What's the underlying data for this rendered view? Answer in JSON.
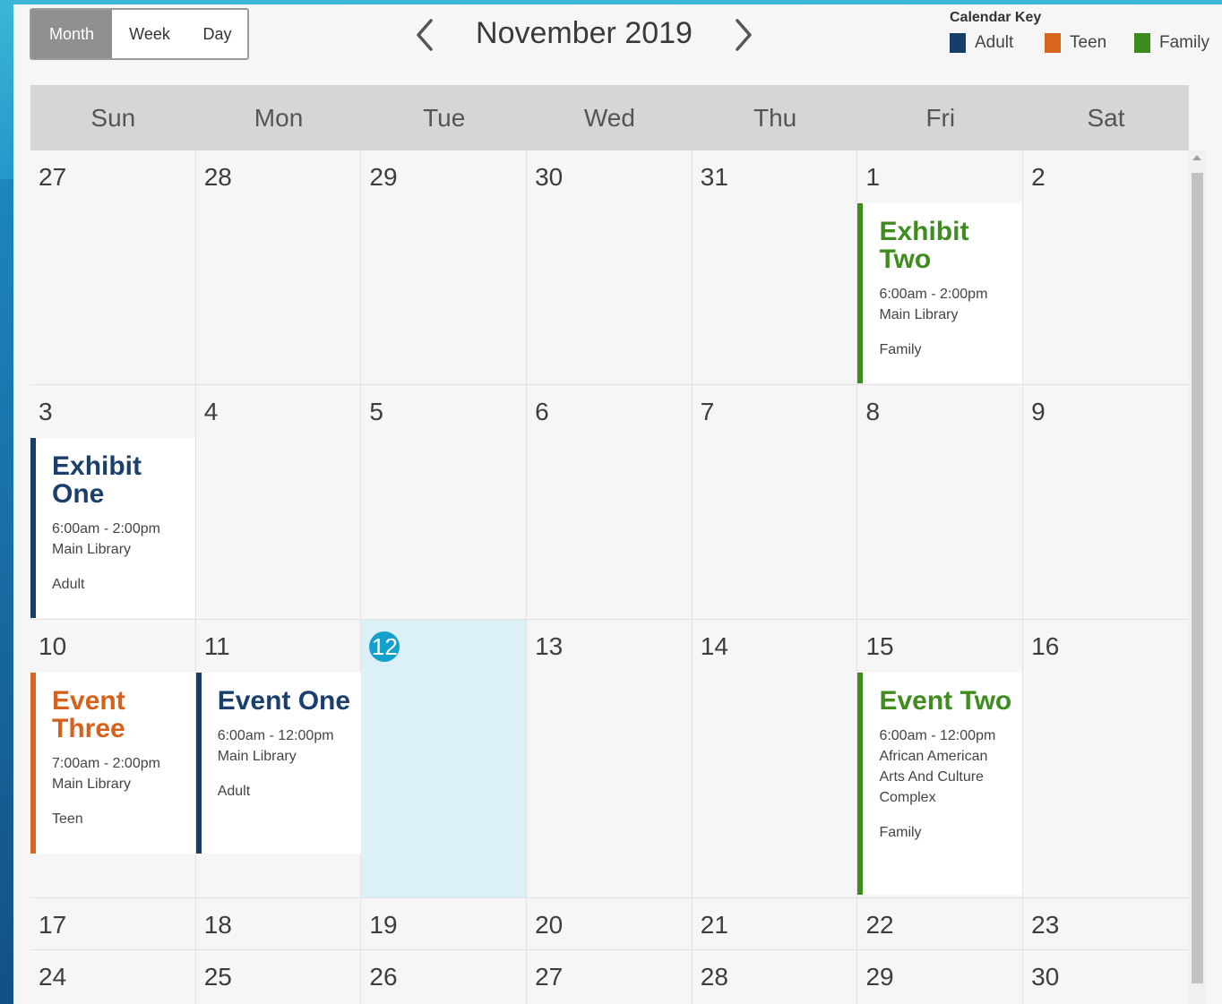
{
  "header": {
    "views": [
      "Month",
      "Week",
      "Day"
    ],
    "active_view": "Month",
    "month_title": "November 2019"
  },
  "calendar_key": {
    "title": "Calendar Key",
    "items": [
      {
        "label": "Adult",
        "color": "#173d6b"
      },
      {
        "label": "Teen",
        "color": "#d7651f"
      },
      {
        "label": "Family",
        "color": "#3c8c1c"
      }
    ]
  },
  "weekdays": [
    "Sun",
    "Mon",
    "Tue",
    "Wed",
    "Thu",
    "Fri",
    "Sat"
  ],
  "weeks": [
    [
      "27",
      "28",
      "29",
      "30",
      "31",
      "1",
      "2"
    ],
    [
      "3",
      "4",
      "5",
      "6",
      "7",
      "8",
      "9"
    ],
    [
      "10",
      "11",
      "12",
      "13",
      "14",
      "15",
      "16"
    ],
    [
      "17",
      "18",
      "19",
      "20",
      "21",
      "22",
      "23"
    ],
    [
      "24",
      "25",
      "26",
      "27",
      "28",
      "29",
      "30"
    ]
  ],
  "today": "12",
  "events": {
    "exhibit_two": {
      "title": "Exhibit Two",
      "time": "6:00am - 2:00pm",
      "location": "Main Library",
      "category": "Family"
    },
    "exhibit_one": {
      "title": "Exhibit One",
      "time": "6:00am - 2:00pm",
      "location": "Main Library",
      "category": "Adult"
    },
    "event_three": {
      "title": "Event Three",
      "time": "7:00am - 2:00pm",
      "location": "Main Library",
      "category": "Teen"
    },
    "event_one": {
      "title": "Event One",
      "time": "6:00am - 12:00pm",
      "location": "Main Library",
      "category": "Adult"
    },
    "event_two": {
      "title": "Event Two",
      "time": "6:00am - 12:00pm",
      "location": "African American Arts And Culture Complex",
      "category": "Family"
    }
  }
}
